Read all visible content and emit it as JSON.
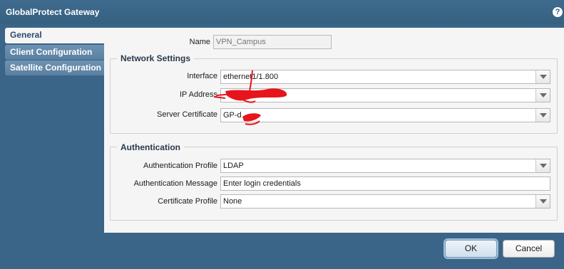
{
  "window": {
    "title": "GlobalProtect Gateway",
    "help_icon": "?"
  },
  "tabs": [
    {
      "label": "General",
      "active": true
    },
    {
      "label": "Client Configuration",
      "active": false
    },
    {
      "label": "Satellite Configuration",
      "active": false
    }
  ],
  "general": {
    "name_label": "Name",
    "name_placeholder": "VPN_Campus"
  },
  "network_settings": {
    "legend": "Network Settings",
    "interface_label": "Interface",
    "interface_value": "ethernet1/1.800",
    "ip_address_label": "IP Address",
    "ip_address_value": "",
    "server_certificate_label": "Server Certificate",
    "server_certificate_value": "GP-d"
  },
  "authentication": {
    "legend": "Authentication",
    "profile_label": "Authentication Profile",
    "profile_value": "LDAP",
    "message_label": "Authentication Message",
    "message_value": "Enter login credentials",
    "certificate_profile_label": "Certificate Profile",
    "certificate_profile_value": "None"
  },
  "footer": {
    "ok_label": "OK",
    "cancel_label": "Cancel"
  },
  "colors": {
    "frame": "#3a6488",
    "panel": "#f5f5f5",
    "scribble": "#e8141c"
  },
  "icons": {
    "help": "help-icon",
    "dropdown": "chevron-down-icon"
  }
}
